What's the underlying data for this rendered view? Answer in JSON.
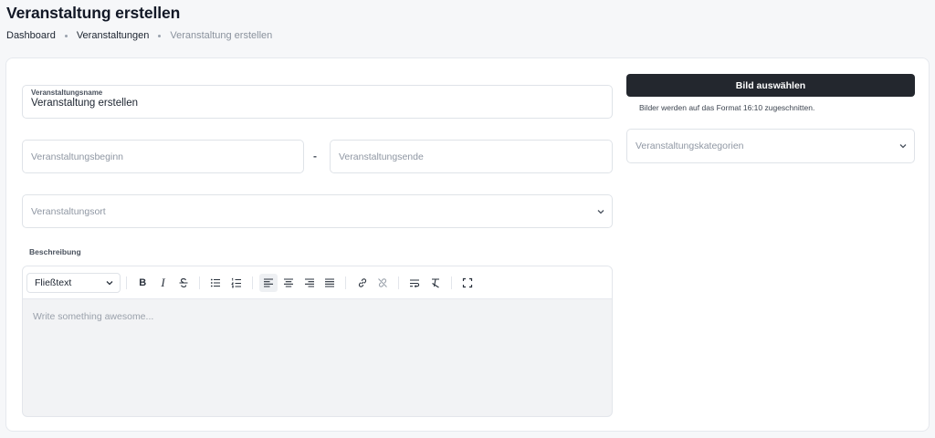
{
  "header": {
    "title": "Veranstaltung erstellen",
    "breadcrumb": [
      "Dashboard",
      "Veranstaltungen",
      "Veranstaltung erstellen"
    ]
  },
  "form": {
    "name": {
      "label": "Veranstaltungsname",
      "value": "Veranstaltung erstellen"
    },
    "start_placeholder": "Veranstaltungsbeginn",
    "range_separator": "-",
    "end_placeholder": "Veranstaltungsende",
    "location_placeholder": "Veranstaltungsort",
    "description_label": "Beschreibung"
  },
  "editor": {
    "style_select": "Fließtext",
    "tools": [
      "bold-icon",
      "italic-icon",
      "strikethrough-icon",
      "bullet-list-icon",
      "ordered-list-icon",
      "align-left-icon",
      "align-center-icon",
      "align-right-icon",
      "align-justify-icon",
      "link-icon",
      "unlink-icon",
      "wrap-text-icon",
      "clear-format-icon",
      "fullscreen-icon"
    ],
    "placeholder": "Write something awesome..."
  },
  "sidebar": {
    "image_button": "Bild auswählen",
    "image_hint": "Bilder werden auf das Format 16:10 zugeschnitten.",
    "categories_placeholder": "Veranstaltungskategorien"
  },
  "colors": {
    "primary_button": "#23272e",
    "card_bg": "#ffffff",
    "page_bg": "#f6f7f9"
  }
}
